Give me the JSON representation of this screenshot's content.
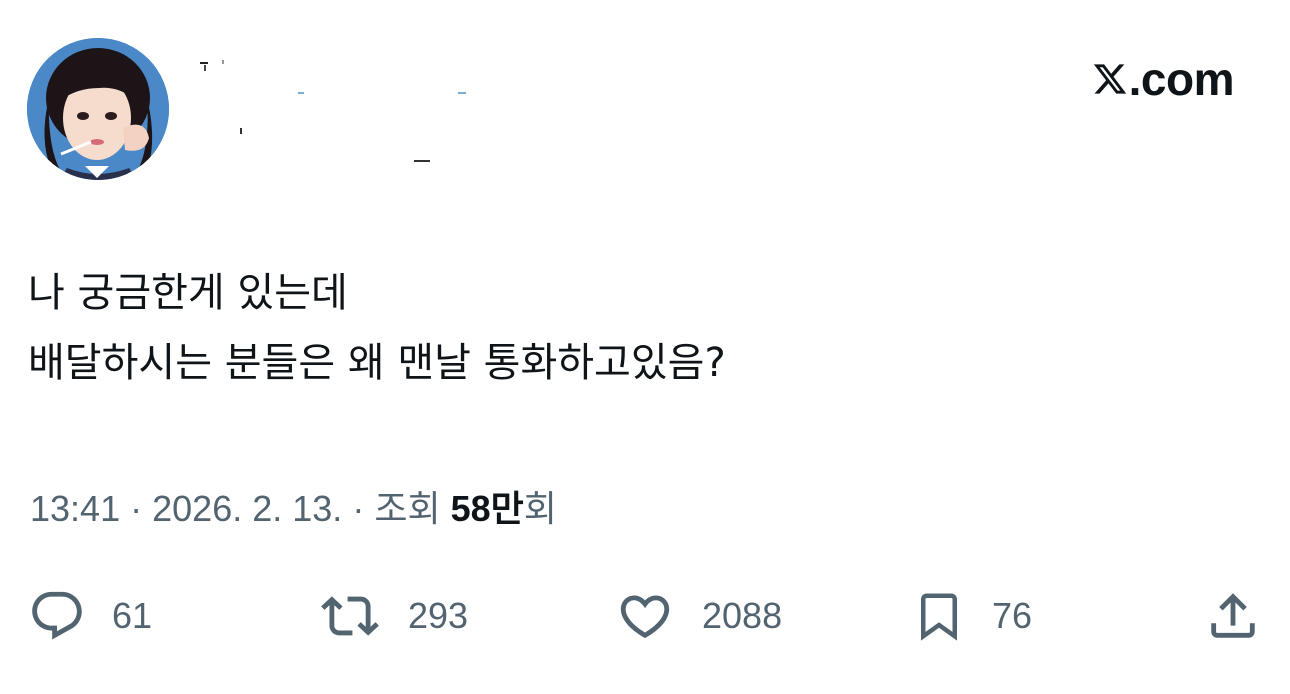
{
  "header": {
    "brand_label": ".com",
    "brand_icon": "x-logo-icon"
  },
  "tweet": {
    "lines": [
      "나 궁금한게 있는데",
      "배달하시는 분들은 왜 맨날 통화하고있음?"
    ],
    "time": "13:41",
    "separator": "·",
    "date": "2026. 2. 13.",
    "views_prefix": "조회",
    "views_count": "58만",
    "views_suffix": "회"
  },
  "actions": {
    "reply": {
      "icon": "reply-icon",
      "count": "61"
    },
    "retweet": {
      "icon": "retweet-icon",
      "count": "293"
    },
    "like": {
      "icon": "heart-icon",
      "count": "2088"
    },
    "bookmark": {
      "icon": "bookmark-icon",
      "count": "76"
    },
    "share": {
      "icon": "share-icon"
    }
  },
  "colors": {
    "text_primary": "#0f1419",
    "text_secondary": "#536471",
    "avatar_bg": "#3a7fc4"
  }
}
